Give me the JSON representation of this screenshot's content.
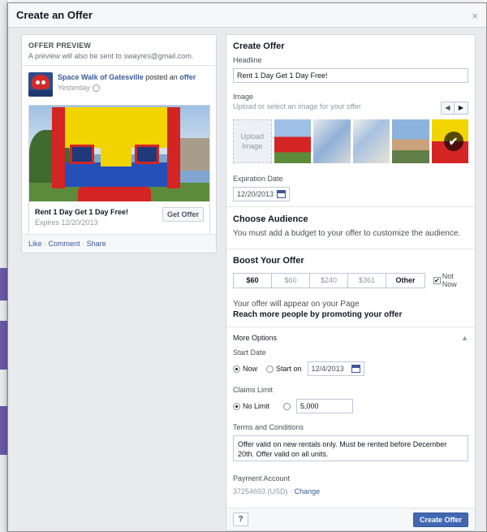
{
  "dialog": {
    "title": "Create an Offer",
    "close_label": "×"
  },
  "preview": {
    "title": "OFFER PREVIEW",
    "subtitle": "A preview will also be sent to swayres@gmail.com.",
    "page_name": "Space Walk of Gatesville",
    "action_text": "posted an",
    "action_link": "offer",
    "time": "Yesterday",
    "headline": "Rent 1 Day Get 1 Day Free!",
    "expires": "Expires 12/20/2013",
    "get_offer_label": "Get Offer",
    "actions": [
      "Like",
      "Comment",
      "Share"
    ],
    "separator": "·"
  },
  "form": {
    "title": "Create Offer",
    "headline_label": "Headline",
    "headline_value": "Rent 1 Day Get 1 Day Free!",
    "image_label": "Image",
    "image_help": "Upload or select an image for your offer",
    "upload_label": "Upload Image",
    "prev_label": "◀",
    "next_label": "▶",
    "check_label": "✔",
    "expiration_label": "Expiration Date",
    "expiration_value": "12/20/2013"
  },
  "audience": {
    "title": "Choose Audience",
    "message": "You must add a budget to your offer to customize the audience."
  },
  "boost": {
    "title": "Boost Your Offer",
    "options": [
      "$60",
      "$60",
      "$240",
      "$361",
      "Other"
    ],
    "not_now_label": "Not Now",
    "check_mark": "✔",
    "info": "Your offer will appear on your Page",
    "promo": "Reach more people by promoting your offer"
  },
  "more": {
    "title": "More Options",
    "start_label": "Start Date",
    "now_label": "Now",
    "start_on_label": "Start on",
    "start_date_value": "12/4/2013",
    "claims_label": "Claims Limit",
    "no_limit_label": "No Limit",
    "claims_value": "5,000",
    "terms_label": "Terms and Conditions",
    "terms_value": "Offer valid on new rentals only. Must be rented before December 20th. Offer valid on all units.",
    "payment_label": "Payment Account",
    "payment_account": "37254693 (USD)",
    "payment_sep": "·",
    "change_label": "Change"
  },
  "footer": {
    "help_label": "?",
    "create_label": "Create Offer"
  },
  "colors": {
    "brand": "#3b5998",
    "primary_button": "#4267b2"
  }
}
